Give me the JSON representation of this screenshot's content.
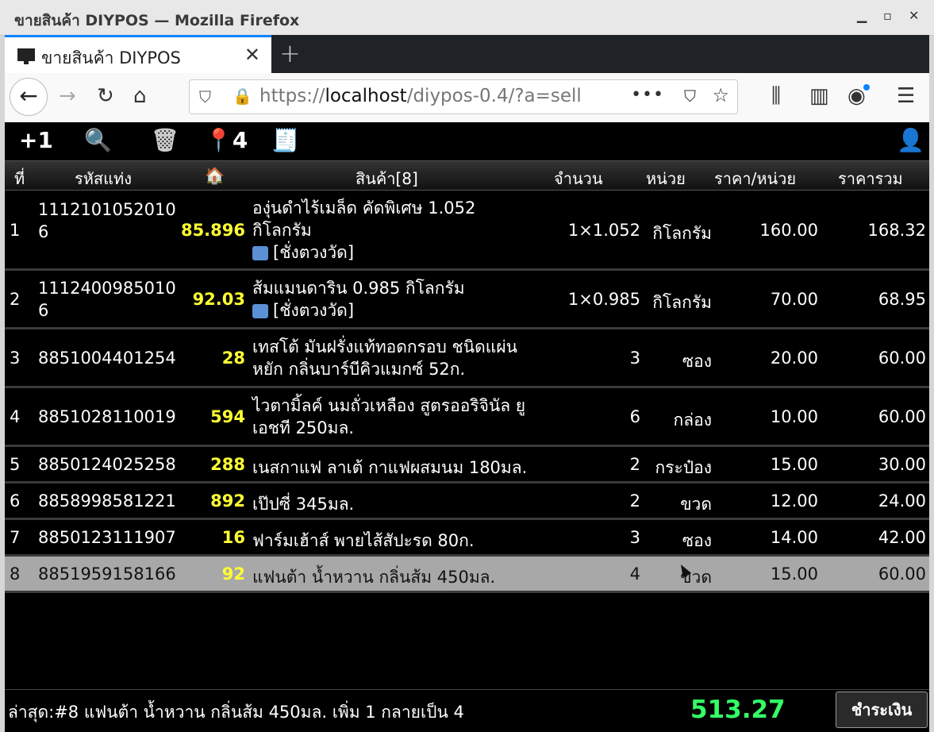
{
  "window": {
    "title": "ขายสินค้า DIYPOS — Mozilla Firefox"
  },
  "tab": {
    "label": "ขายสินค้า DIYPOS"
  },
  "url": {
    "prefix": "https://",
    "host": "localhost",
    "path": "/diypos-0.4/?a=sell"
  },
  "toolbar": {
    "plus_one": "+1",
    "pin_count": "4"
  },
  "table": {
    "headers": {
      "no": "ที่",
      "barcode": "รหัสแท่ง",
      "product": "สินค้า[8]",
      "qty": "จำนวน",
      "unit": "หน่วย",
      "price": "ราคา/หน่วย",
      "total": "ราคารวม"
    },
    "rows": [
      {
        "no": "1",
        "barcode1": "1112101052010",
        "barcode2": "6",
        "stock": "85.896",
        "name1": "องุ่นดำไร้เมล็ด คัดพิเศษ 1.052",
        "name2": "กิโลกรัม",
        "note": "[ชั่งตวงวัด]",
        "qty": "1×1.052",
        "unit": "กิโลกรัม",
        "price": "160.00",
        "total": "168.32"
      },
      {
        "no": "2",
        "barcode1": "1112400985010",
        "barcode2": "6",
        "stock": "92.03",
        "name1": "ส้มแมนดาริน 0.985 กิโลกรัม",
        "note": "[ชั่งตวงวัด]",
        "qty": "1×0.985",
        "unit": "กิโลกรัม",
        "price": "70.00",
        "total": "68.95"
      },
      {
        "no": "3",
        "barcode1": "8851004401254",
        "stock": "28",
        "name1": "เทสโต้ มันฝรั่งแท้ทอดกรอบ ชนิดแผ่น",
        "name2": "หยัก กลิ่นบาร์บีคิวแมกซ์ 52ก.",
        "qty": "3",
        "unit": "ซอง",
        "price": "20.00",
        "total": "60.00"
      },
      {
        "no": "4",
        "barcode1": "8851028110019",
        "stock": "594",
        "name1": "ไวตามิ้ลค์ นมถั่วเหลือง สูตรออริจินัล ยู",
        "name2": "เอชที 250มล.",
        "qty": "6",
        "unit": "กล่อง",
        "price": "10.00",
        "total": "60.00"
      },
      {
        "no": "5",
        "barcode1": "8850124025258",
        "stock": "288",
        "name1": "เนสกาแฟ ลาเต้ กาแฟผสมนม 180มล.",
        "qty": "2",
        "unit": "กระป๋อง",
        "price": "15.00",
        "total": "30.00"
      },
      {
        "no": "6",
        "barcode1": "8858998581221",
        "stock": "892",
        "name1": "เป๊ปซี่ 345มล.",
        "qty": "2",
        "unit": "ขวด",
        "price": "12.00",
        "total": "24.00"
      },
      {
        "no": "7",
        "barcode1": "8850123111907",
        "stock": "16",
        "name1": "ฟาร์มเฮ้าส์ พายไส้สัปะรด 80ก.",
        "qty": "3",
        "unit": "ซอง",
        "price": "14.00",
        "total": "42.00"
      },
      {
        "no": "8",
        "barcode1": "8851959158166",
        "stock": "92",
        "name1": "แฟนต้า น้ำหวาน กลิ่นส้ม 450มล.",
        "qty": "4",
        "unit": "ขวด",
        "price": "15.00",
        "total": "60.00"
      }
    ]
  },
  "footer": {
    "last": "ล่าสุด:#8 แฟนต้า น้ำหวาน กลิ่นส้ม 450มล. เพิ่ม 1 กลายเป็น 4",
    "total": "513.27",
    "pay_label": "ชำระเงิน"
  },
  "colors": {
    "stock": "#ffff33",
    "grand_total": "#33ff66",
    "selected_row": "#a8a8a8"
  }
}
